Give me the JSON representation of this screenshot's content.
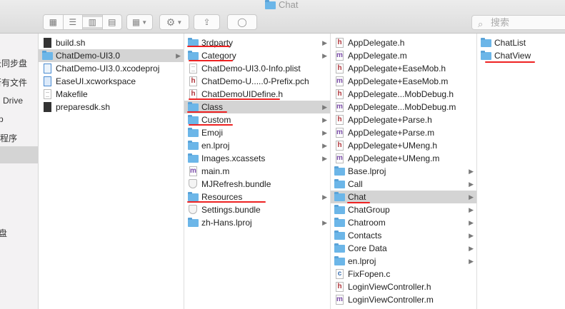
{
  "window": {
    "title": "Chat"
  },
  "toolbar": {
    "search_placeholder": "搜索"
  },
  "sidebar": {
    "items": [
      "云同步盘",
      "所有文件",
      "Drive",
      "p",
      "程序",
      "盘"
    ]
  },
  "columns": [
    {
      "items": [
        {
          "name": "build.sh",
          "icon": "script"
        },
        {
          "name": "ChatDemo-UI3.0",
          "icon": "folder",
          "arrow": true,
          "selected": true
        },
        {
          "name": "ChatDemo-UI3.0.xcodeproj",
          "icon": "xcodeproj"
        },
        {
          "name": "EaseUI.xcworkspace",
          "icon": "xcworkspace"
        },
        {
          "name": "Makefile",
          "icon": "plain"
        },
        {
          "name": "preparesdk.sh",
          "icon": "script"
        }
      ]
    },
    {
      "items": [
        {
          "name": "3rdparty",
          "icon": "folder",
          "arrow": true
        },
        {
          "name": "Category",
          "icon": "folder",
          "arrow": true
        },
        {
          "name": "ChatDemo-UI3.0-Info.plist",
          "icon": "plain"
        },
        {
          "name": "ChatDemo-U.....0-Prefix.pch",
          "icon": "h"
        },
        {
          "name": "ChatDemoUIDefine.h",
          "icon": "h"
        },
        {
          "name": "Class",
          "icon": "folder",
          "arrow": true,
          "selected": true
        },
        {
          "name": "Custom",
          "icon": "folder",
          "arrow": true
        },
        {
          "name": "Emoji",
          "icon": "folder",
          "arrow": true
        },
        {
          "name": "en.lproj",
          "icon": "folder",
          "arrow": true
        },
        {
          "name": "Images.xcassets",
          "icon": "folder",
          "arrow": true
        },
        {
          "name": "main.m",
          "icon": "m"
        },
        {
          "name": "MJRefresh.bundle",
          "icon": "bundle"
        },
        {
          "name": "Resources",
          "icon": "folder",
          "arrow": true
        },
        {
          "name": "Settings.bundle",
          "icon": "bundle"
        },
        {
          "name": "zh-Hans.lproj",
          "icon": "folder",
          "arrow": true
        }
      ]
    },
    {
      "items": [
        {
          "name": "AppDelegate.h",
          "icon": "h"
        },
        {
          "name": "AppDelegate.m",
          "icon": "m"
        },
        {
          "name": "AppDelegate+EaseMob.h",
          "icon": "h"
        },
        {
          "name": "AppDelegate+EaseMob.m",
          "icon": "m"
        },
        {
          "name": "AppDelegate...MobDebug.h",
          "icon": "h"
        },
        {
          "name": "AppDelegate...MobDebug.m",
          "icon": "m"
        },
        {
          "name": "AppDelegate+Parse.h",
          "icon": "h"
        },
        {
          "name": "AppDelegate+Parse.m",
          "icon": "m"
        },
        {
          "name": "AppDelegate+UMeng.h",
          "icon": "h"
        },
        {
          "name": "AppDelegate+UMeng.m",
          "icon": "m"
        },
        {
          "name": "Base.lproj",
          "icon": "folder",
          "arrow": true
        },
        {
          "name": "Call",
          "icon": "folder",
          "arrow": true
        },
        {
          "name": "Chat",
          "icon": "folder",
          "arrow": true,
          "selected": true
        },
        {
          "name": "ChatGroup",
          "icon": "folder",
          "arrow": true
        },
        {
          "name": "Chatroom",
          "icon": "folder",
          "arrow": true
        },
        {
          "name": "Contacts",
          "icon": "folder",
          "arrow": true
        },
        {
          "name": "Core Data",
          "icon": "folder",
          "arrow": true
        },
        {
          "name": "en.lproj",
          "icon": "folder",
          "arrow": true
        },
        {
          "name": "FixFopen.c",
          "icon": "c"
        },
        {
          "name": "LoginViewController.h",
          "icon": "h"
        },
        {
          "name": "LoginViewController.m",
          "icon": "m"
        }
      ]
    },
    {
      "items": [
        {
          "name": "ChatList",
          "icon": "folder"
        },
        {
          "name": "ChatView",
          "icon": "folder"
        }
      ]
    }
  ],
  "colors": {
    "annotation": "#e22222",
    "folder": "#6cb6e8",
    "selection": "#d4d4d4"
  }
}
